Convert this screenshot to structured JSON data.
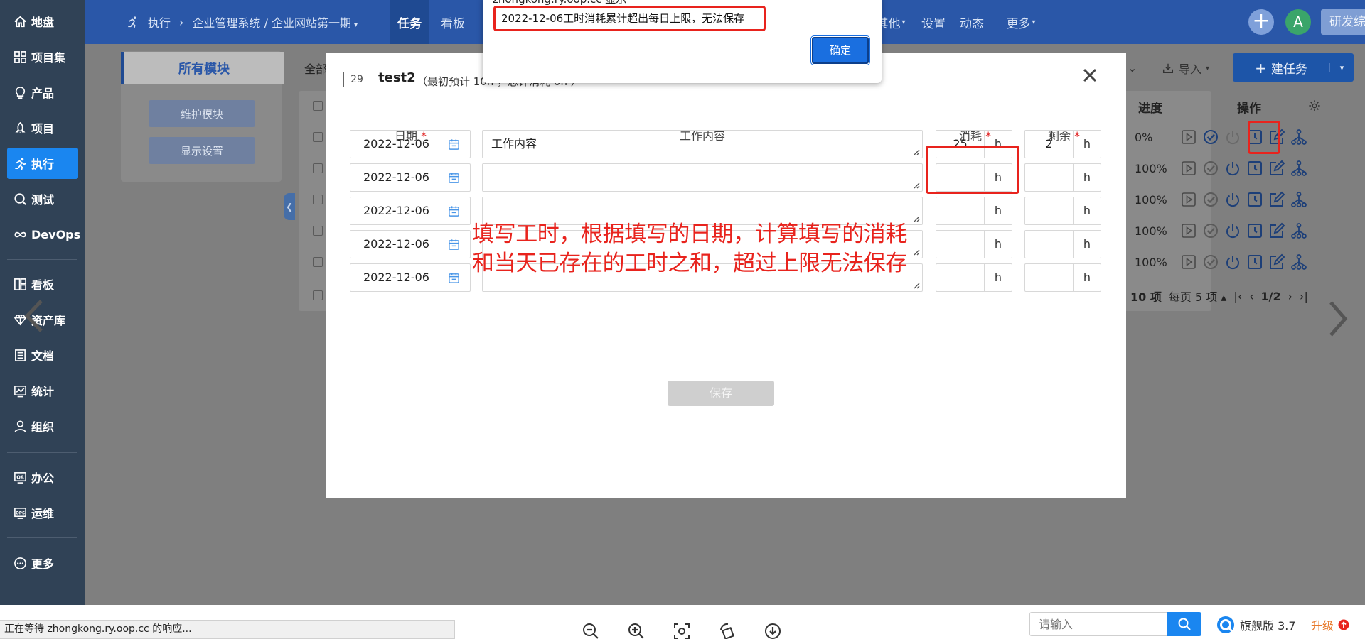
{
  "sidebar": {
    "items": [
      {
        "label": "地盘",
        "icon": "home-icon"
      },
      {
        "label": "项目集",
        "icon": "grid-icon"
      },
      {
        "label": "产品",
        "icon": "bulb-icon"
      },
      {
        "label": "项目",
        "icon": "rocket-icon"
      },
      {
        "label": "执行",
        "icon": "run-icon"
      },
      {
        "label": "测试",
        "icon": "search-icon"
      },
      {
        "label": "DevOps",
        "icon": "infinity-icon"
      },
      {
        "label": "看板",
        "icon": "board-icon"
      },
      {
        "label": "资产库",
        "icon": "diamond-icon"
      },
      {
        "label": "文档",
        "icon": "doc-icon"
      },
      {
        "label": "统计",
        "icon": "chart-icon"
      },
      {
        "label": "组织",
        "icon": "user-icon"
      },
      {
        "label": "办公",
        "icon": "oa-icon"
      },
      {
        "label": "运维",
        "icon": "ops-icon"
      },
      {
        "label": "更多",
        "icon": "more-icon"
      }
    ],
    "active": "执行"
  },
  "topbar": {
    "breadcrumb_section": "执行",
    "breadcrumb_project": "企业管理系统 / 企业网站第一期",
    "tabs": [
      "任务",
      "看板",
      "其他",
      "设置",
      "动态",
      "更多"
    ],
    "active_tab": "任务",
    "avatar_letter": "A",
    "switch_label": "研发综合界面"
  },
  "page": {
    "module_tab": "所有模块",
    "maintain_module": "维护模块",
    "display_settings": "显示设置",
    "all_label": "全部",
    "import_label": "导入",
    "create_task": "建任务",
    "columns": {
      "progress": "进度",
      "actions": "操作"
    },
    "progress_values": [
      "0%",
      "100%",
      "100%",
      "100%",
      "100%"
    ],
    "pager": {
      "total": "10 项",
      "per_page": "每页 5 项",
      "page": "1/2"
    }
  },
  "modal": {
    "task_id": "29",
    "task_name": "test2",
    "meta": "（最初预计  10h  ，总计消耗  0h  ）",
    "headers": {
      "date": "日期",
      "content": "工作内容",
      "consumed": "消耗",
      "remaining": "剩余",
      "required_mark": "*"
    },
    "rows": [
      {
        "date": "2022-12-06",
        "content": "工作内容",
        "consumed": "25",
        "remaining": "2"
      },
      {
        "date": "2022-12-06",
        "content": "",
        "consumed": "",
        "remaining": ""
      },
      {
        "date": "2022-12-06",
        "content": "",
        "consumed": "",
        "remaining": ""
      },
      {
        "date": "2022-12-06",
        "content": "",
        "consumed": "",
        "remaining": ""
      },
      {
        "date": "2022-12-06",
        "content": "",
        "consumed": "",
        "remaining": ""
      }
    ],
    "unit": "h",
    "save_label": "保存"
  },
  "annotation": {
    "line1": "填写工时，根据填写的日期，计算填写的消耗",
    "line2": "和当天已存在的工时之和，超过上限无法保存"
  },
  "alert": {
    "header": "zhongkong.ry.oop.cc 显示",
    "message": "2022-12-06工时消耗累计超出每日上限，无法保存",
    "ok_label": "确定"
  },
  "bottom": {
    "status_text": "正在等待 zhongkong.ry.oop.cc 的响应...",
    "search_placeholder": "请输入",
    "version_label": "旗舰版 3.7",
    "upgrade_label": "升级"
  },
  "colors": {
    "sidebar": "#304256",
    "topbar": "#2a57a8",
    "accent": "#1a86f0",
    "annotation_red": "#e8231d"
  }
}
